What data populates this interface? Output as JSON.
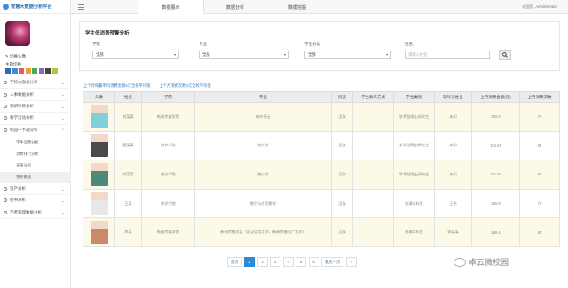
{
  "app": {
    "title": "智慧大数据分析平台"
  },
  "sidebar": {
    "avatar_link": "✎ 切换头像",
    "theme_label": "主题切换",
    "theme_colors": [
      "#2b6cb0",
      "#3f8ed8",
      "#e55c5c",
      "#e9a13b",
      "#49a85c",
      "#8b63c9",
      "#444444",
      "#a7c93c"
    ],
    "items": [
      {
        "label": "学校大盘总分析"
      },
      {
        "label": "人事数据分析"
      },
      {
        "label": "科研项目分析"
      },
      {
        "label": "教学活动分析"
      },
      {
        "label": "校园一卡通分析"
      },
      {
        "label": "资产分析"
      },
      {
        "label": "图书分析"
      },
      {
        "label": "学者管理数据分析"
      }
    ],
    "sub_items": [
      {
        "label": "学生消费分析"
      },
      {
        "label": "消费排行分析"
      },
      {
        "label": "充值分析"
      },
      {
        "label": "预警推送"
      }
    ]
  },
  "topbar": {
    "tabs": [
      {
        "label": "数据展示"
      },
      {
        "label": "数据分析"
      },
      {
        "label": "数据挖掘"
      }
    ],
    "user": "欢迎您, Administrator"
  },
  "filter": {
    "title": "学生低消费预警分析",
    "college_label": "学院",
    "college_value": "全部",
    "major_label": "专业",
    "major_value": "全部",
    "category_label": "学生分类",
    "category_value": "全部",
    "name_label": "姓名",
    "name_placeholder": "请输入姓名"
  },
  "links": {
    "link1": "上个月每餐平均消费金额5元全校平均值",
    "link2": "上个月消费次数5元全校平均值"
  },
  "table": {
    "headers": [
      "头像",
      "姓名",
      "学院",
      "专业",
      "民族",
      "学生联系方式",
      "学生类别",
      "辅导员姓名",
      "上月消费金额(元)",
      "上月消费次数"
    ],
    "rows": [
      {
        "name": "何某某",
        "college": "新闻传媒学院",
        "major": "海外硕士",
        "ethnic": "汉族",
        "contact": "",
        "category": "学术型硕士研究生",
        "counselor": "未知",
        "amount": "120.0",
        "count": "70",
        "photo": "#7fd0d8"
      },
      {
        "name": "唐某某",
        "college": "统计学院",
        "major": "统计学",
        "ethnic": "汉族",
        "contact": "",
        "category": "学术型硕士研究生",
        "counselor": "未知",
        "amount": "152.51",
        "count": "64",
        "photo": "#4a4a4a"
      },
      {
        "name": "刘某某",
        "college": "统计学院",
        "major": "统计学",
        "ethnic": "汉族",
        "contact": "",
        "category": "学术型硕士研究生",
        "counselor": "未知",
        "amount": "151.61",
        "count": "68",
        "photo": "#4d8a7c"
      },
      {
        "name": "王某",
        "college": "数学学院",
        "major": "数学与应用数学",
        "ethnic": "汉族",
        "contact": "",
        "category": "普通本科生",
        "counselor": "王杰",
        "amount": "255.8",
        "count": "70",
        "photo": "#e8e8e8"
      },
      {
        "name": "李某",
        "college": "新闻传媒学院",
        "major": "新闻传播学类（含汉语言文学、新闻传播与广告学）",
        "ethnic": "汉族",
        "contact": "",
        "category": "普通本科生",
        "counselor": "郭某某",
        "amount": "268.4",
        "count": "64",
        "photo": "#c98a6a"
      }
    ]
  },
  "pagination": {
    "first": "首页",
    "pages": [
      "1",
      "2",
      "3",
      "4",
      "5",
      "6"
    ],
    "last": "最后一页",
    "next": "»"
  },
  "watermark": {
    "text": "卓云微校园"
  }
}
